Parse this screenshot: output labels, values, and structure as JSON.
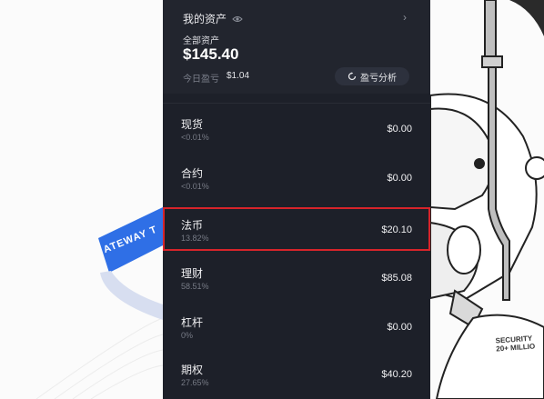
{
  "header": {
    "title": "我的资产",
    "total_label": "全部资产",
    "total_value": "$145.40",
    "pnl_label": "今日盈亏",
    "pnl_value": "$1.04",
    "analysis_button": "盈亏分析"
  },
  "accounts": [
    {
      "name": "现货",
      "pct": "<0.01%",
      "amount": "$0.00"
    },
    {
      "name": "合约",
      "pct": "<0.01%",
      "amount": "$0.00"
    },
    {
      "name": "法币",
      "pct": "13.82%",
      "amount": "$20.10",
      "highlighted": true
    },
    {
      "name": "理财",
      "pct": "58.51%",
      "amount": "$85.08"
    },
    {
      "name": "杠杆",
      "pct": "0%",
      "amount": "$0.00"
    },
    {
      "name": "期权",
      "pct": "27.65%",
      "amount": "$40.20"
    }
  ],
  "background": {
    "ribbon_text": "ATEWAY T",
    "security_line1": "SECURITY",
    "security_line2": "20+ MILLIO"
  },
  "colors": {
    "panel_bg": "#1d2029",
    "header_bg": "#22252e",
    "highlight_border": "#d7242a",
    "ribbon_blue": "#2f6fe6"
  }
}
